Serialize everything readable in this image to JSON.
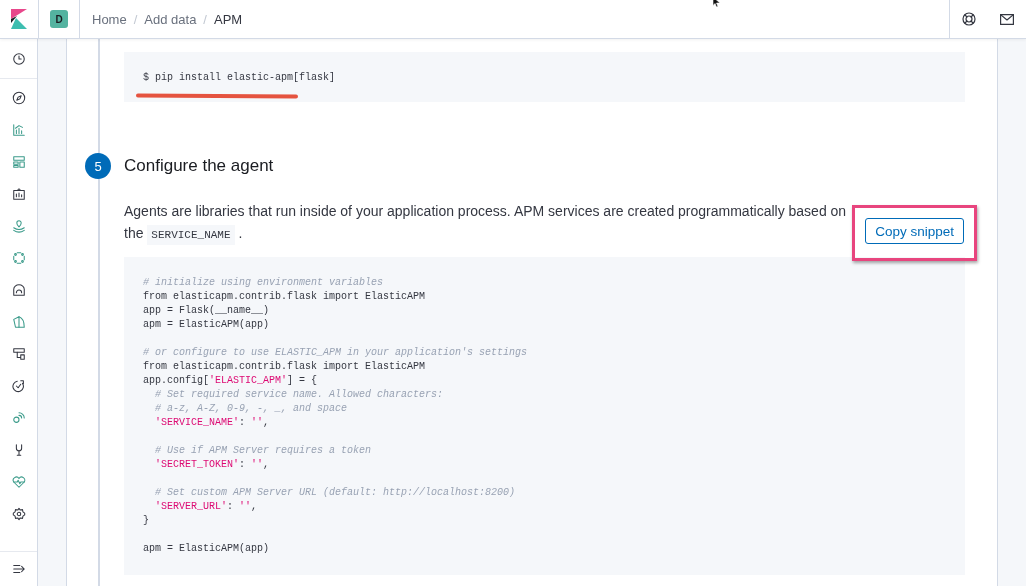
{
  "header": {
    "avatar": "D",
    "separator": "/",
    "breadcrumbs": [
      {
        "label": "Home",
        "current": false
      },
      {
        "label": "Add data",
        "current": false
      },
      {
        "label": "APM",
        "current": true
      }
    ]
  },
  "install_code": "$ pip install elastic-apm[flask]",
  "step": {
    "number": "5",
    "title": "Configure the agent",
    "text_before": "Agents are libraries that run inside of your application process. APM services are created programmatically based on the",
    "code_chip": "SERVICE_NAME",
    "text_after": ".",
    "copy_button": "Copy snippet"
  },
  "config_code": [
    {
      "kind": "line",
      "segments": [
        {
          "kind": "comment",
          "text": "# initialize using environment variables"
        }
      ]
    },
    {
      "kind": "line",
      "segments": [
        {
          "kind": "code",
          "text": "from elasticapm.contrib.flask import ElasticAPM"
        }
      ]
    },
    {
      "kind": "line",
      "segments": [
        {
          "kind": "code",
          "text": "app = Flask(__name__)"
        }
      ]
    },
    {
      "kind": "line",
      "segments": [
        {
          "kind": "code",
          "text": "apm = ElasticAPM(app)"
        }
      ]
    },
    {
      "kind": "blank"
    },
    {
      "kind": "line",
      "segments": [
        {
          "kind": "comment",
          "text": "# or configure to use ELASTIC_APM in your application's settings"
        }
      ]
    },
    {
      "kind": "line",
      "segments": [
        {
          "kind": "code",
          "text": "from elasticapm.contrib.flask import ElasticAPM"
        }
      ]
    },
    {
      "kind": "line",
      "segments": [
        {
          "kind": "code",
          "text": "app.config["
        },
        {
          "kind": "string",
          "text": "'ELASTIC_APM'"
        },
        {
          "kind": "code",
          "text": "] = {"
        }
      ]
    },
    {
      "kind": "line",
      "segments": [
        {
          "kind": "comment",
          "text": "  # Set required service name. Allowed characters:"
        }
      ]
    },
    {
      "kind": "line",
      "segments": [
        {
          "kind": "comment",
          "text": "  # a-z, A-Z, 0-9, -, _, and space"
        }
      ]
    },
    {
      "kind": "line",
      "segments": [
        {
          "kind": "string",
          "text": "  'SERVICE_NAME'"
        },
        {
          "kind": "code",
          "text": ": "
        },
        {
          "kind": "string",
          "text": "''"
        },
        {
          "kind": "code",
          "text": ","
        }
      ]
    },
    {
      "kind": "blank"
    },
    {
      "kind": "line",
      "segments": [
        {
          "kind": "comment",
          "text": "  # Use if APM Server requires a token"
        }
      ]
    },
    {
      "kind": "line",
      "segments": [
        {
          "kind": "string",
          "text": "  'SECRET_TOKEN'"
        },
        {
          "kind": "code",
          "text": ": "
        },
        {
          "kind": "string",
          "text": "''"
        },
        {
          "kind": "code",
          "text": ","
        }
      ]
    },
    {
      "kind": "blank"
    },
    {
      "kind": "line",
      "segments": [
        {
          "kind": "comment",
          "text": "  # Set custom APM Server URL (default: http://localhost:8200)"
        }
      ]
    },
    {
      "kind": "line",
      "segments": [
        {
          "kind": "string",
          "text": "  'SERVER_URL'"
        },
        {
          "kind": "code",
          "text": ": "
        },
        {
          "kind": "string",
          "text": "''"
        },
        {
          "kind": "code",
          "text": ","
        }
      ]
    },
    {
      "kind": "line",
      "segments": [
        {
          "kind": "code",
          "text": "}"
        }
      ]
    },
    {
      "kind": "blank"
    },
    {
      "kind": "line",
      "segments": [
        {
          "kind": "code",
          "text": "apm = ElasticAPM(app)"
        }
      ]
    }
  ]
}
